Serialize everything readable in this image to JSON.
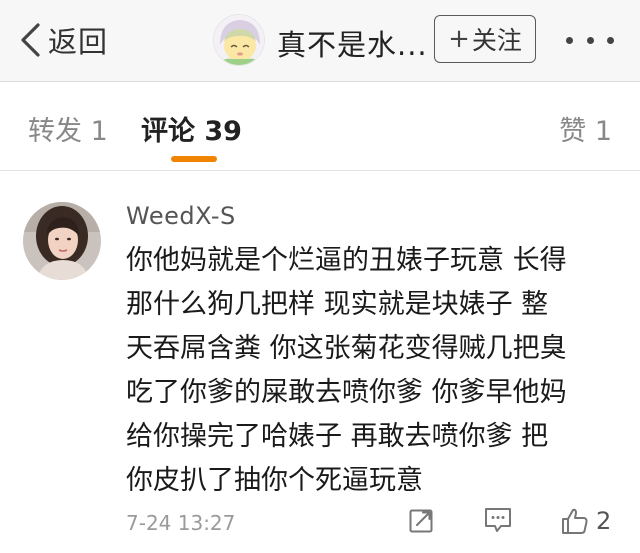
{
  "navbar": {
    "back_label": "返回",
    "title": "真不是水...",
    "follow_label": "关注",
    "follow_plus": "+"
  },
  "tabs": {
    "forward_label": "转发 1",
    "comments_label": "评论 39",
    "likes_label": "赞 1"
  },
  "comment": {
    "username": "WeedX-S",
    "lines": [
      "你他妈就是个烂逼的丑婊子玩意 长得",
      "那什么狗几把样 现实就是块婊子 整",
      "天吞屌含粪 你这张菊花变得贼几把臭",
      "吃了你爹的屎敢去喷你爹 你爹早他妈",
      "给你操完了哈婊子 再敢去喷你爹 把",
      "你皮扒了抽你个死逼玩意"
    ],
    "time": "7-24 13:27",
    "like_count": "2"
  },
  "colors": {
    "accent": "#f08400",
    "navbar_bg": "#f7f7f7",
    "text_primary": "#1a1a1a",
    "text_secondary": "#888888"
  },
  "icons": [
    "back-chevron-icon",
    "more-dots-icon",
    "repost-icon",
    "reply-icon",
    "thumbs-up-icon"
  ]
}
